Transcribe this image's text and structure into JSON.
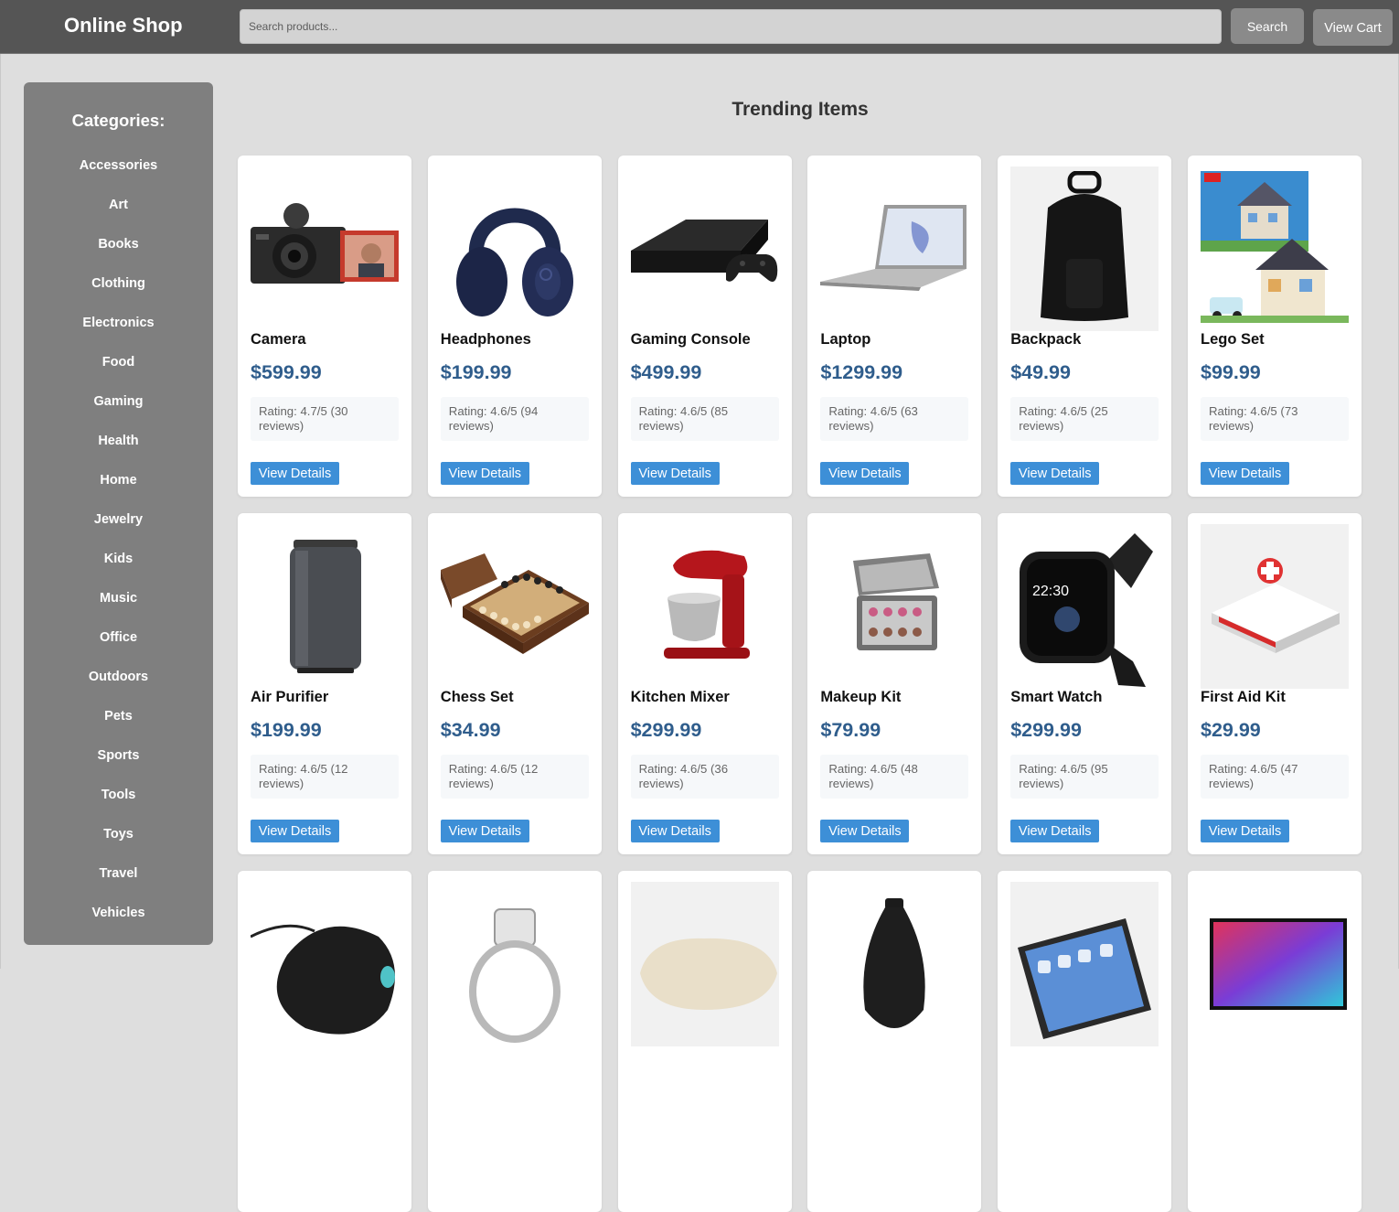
{
  "header": {
    "brand": "Online Shop",
    "search_placeholder": "Search products...",
    "search_label": "Search",
    "cart_label": "View Cart"
  },
  "sidebar": {
    "title": "Categories:",
    "items": [
      "Accessories",
      "Art",
      "Books",
      "Clothing",
      "Electronics",
      "Food",
      "Gaming",
      "Health",
      "Home",
      "Jewelry",
      "Kids",
      "Music",
      "Office",
      "Outdoors",
      "Pets",
      "Sports",
      "Tools",
      "Toys",
      "Travel",
      "Vehicles"
    ]
  },
  "main": {
    "title": "Trending Items",
    "details_label": "View Details",
    "products": [
      {
        "name": "Camera",
        "price": "$599.99",
        "rating": "Rating: 4.7/5 (30 reviews)",
        "icon": "camera-icon"
      },
      {
        "name": "Headphones",
        "price": "$199.99",
        "rating": "Rating: 4.6/5 (94 reviews)",
        "icon": "headphones-icon"
      },
      {
        "name": "Gaming Console",
        "price": "$499.99",
        "rating": "Rating: 4.6/5 (85 reviews)",
        "icon": "game-console-icon"
      },
      {
        "name": "Laptop",
        "price": "$1299.99",
        "rating": "Rating: 4.6/5 (63 reviews)",
        "icon": "laptop-icon"
      },
      {
        "name": "Backpack",
        "price": "$49.99",
        "rating": "Rating: 4.6/5 (25 reviews)",
        "icon": "backpack-icon"
      },
      {
        "name": "Lego Set",
        "price": "$99.99",
        "rating": "Rating: 4.6/5 (73 reviews)",
        "icon": "lego-box-icon"
      },
      {
        "name": "Air Purifier",
        "price": "$199.99",
        "rating": "Rating: 4.6/5 (12 reviews)",
        "icon": "air-purifier-icon"
      },
      {
        "name": "Chess Set",
        "price": "$34.99",
        "rating": "Rating: 4.6/5 (12 reviews)",
        "icon": "chess-board-icon"
      },
      {
        "name": "Kitchen Mixer",
        "price": "$299.99",
        "rating": "Rating: 4.6/5 (36 reviews)",
        "icon": "stand-mixer-icon"
      },
      {
        "name": "Makeup Kit",
        "price": "$79.99",
        "rating": "Rating: 4.6/5 (48 reviews)",
        "icon": "makeup-case-icon"
      },
      {
        "name": "Smart Watch",
        "price": "$299.99",
        "rating": "Rating: 4.6/5 (95 reviews)",
        "icon": "smartwatch-icon"
      },
      {
        "name": "First Aid Kit",
        "price": "$29.99",
        "rating": "Rating: 4.6/5 (47 reviews)",
        "icon": "first-aid-icon"
      },
      {
        "name": "",
        "price": "",
        "rating": "",
        "icon": "mouse-icon"
      },
      {
        "name": "",
        "price": "",
        "rating": "",
        "icon": "ring-icon"
      },
      {
        "name": "",
        "price": "",
        "rating": "",
        "icon": "pillow-icon"
      },
      {
        "name": "",
        "price": "",
        "rating": "",
        "icon": "vase-icon"
      },
      {
        "name": "",
        "price": "",
        "rating": "",
        "icon": "tablet-icon"
      },
      {
        "name": "",
        "price": "",
        "rating": "",
        "icon": "tv-icon"
      }
    ]
  },
  "colors": {
    "header_bg": "#555555",
    "sidebar_bg": "#7f7f7f",
    "page_bg": "#dedede",
    "price": "#2f5d8c",
    "details_button": "#3d8fd7"
  }
}
